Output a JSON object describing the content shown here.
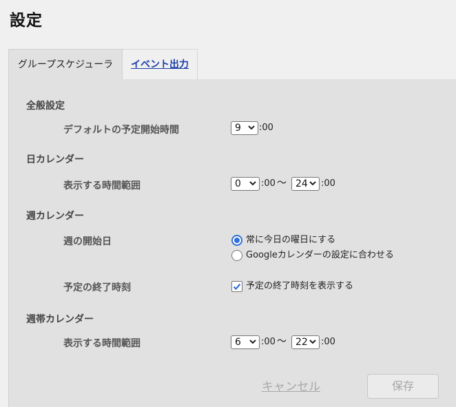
{
  "page": {
    "title": "設定"
  },
  "tabs": [
    {
      "label": "グループスケジューラ",
      "active": true
    },
    {
      "label": "イベント出力",
      "active": false
    }
  ],
  "general": {
    "heading": "全般設定",
    "default_start_label": "デフォルトの予定開始時間",
    "default_start_value": "9",
    "suffix": ":00"
  },
  "day_calendar": {
    "heading": "日カレンダー",
    "range_label": "表示する時間範囲",
    "from": "0",
    "to": "24",
    "suffix": ":00",
    "separator": "〜"
  },
  "week_calendar": {
    "heading": "週カレンダー",
    "start_day_label": "週の開始日",
    "options": [
      {
        "label": "常に今日の曜日にする",
        "selected": true
      },
      {
        "label": "Googleカレンダーの設定に合わせる",
        "selected": false
      }
    ],
    "end_time_label": "予定の終了時刻",
    "end_time_checkbox_label": "予定の終了時刻を表示する",
    "end_time_checked": true
  },
  "week_band_calendar": {
    "heading": "週帯カレンダー",
    "range_label": "表示する時間範囲",
    "from": "6",
    "to": "22",
    "suffix": ":00",
    "separator": "〜"
  },
  "actions": {
    "cancel": "キャンセル",
    "save": "保存"
  },
  "colors": {
    "accent": "#2f6fd6",
    "link": "#1a3ea8",
    "panel": "#e1e1e1"
  }
}
